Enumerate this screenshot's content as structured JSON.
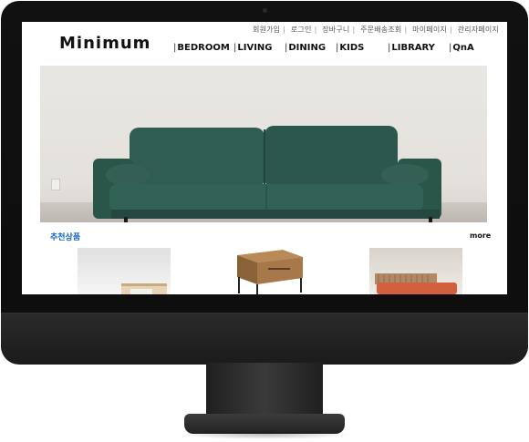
{
  "brand": {
    "logo": "Minimum"
  },
  "top_links": [
    "회원가입",
    "로그인",
    "장바구니",
    "주문배송조회",
    "마이페이지",
    "관리자페이지"
  ],
  "nav": [
    "BEDROOM",
    "LIVING",
    "DINING",
    "KIDS",
    "LIBRARY",
    "QnA"
  ],
  "section": {
    "title": "추천상품",
    "more": "more"
  },
  "colors": {
    "accent": "#1565c0",
    "sofa": "#2f5d52",
    "bezel": "#111111"
  },
  "icons": [
    "camera-icon"
  ]
}
